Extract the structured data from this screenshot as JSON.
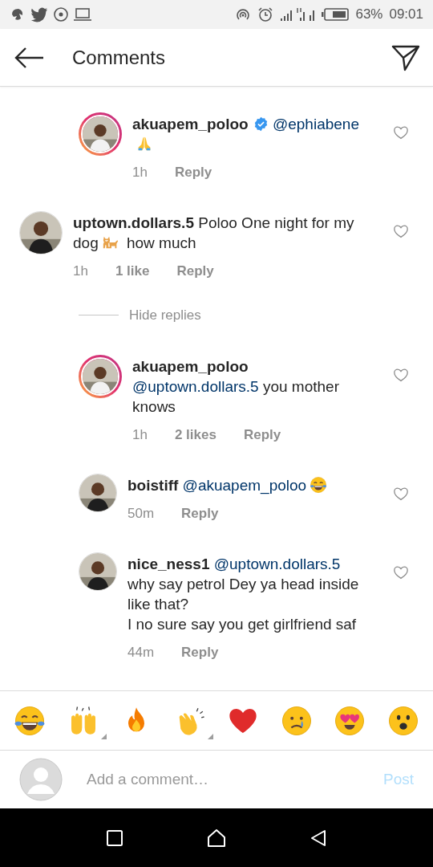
{
  "status_bar": {
    "battery": "63%",
    "time": "09:01"
  },
  "header": {
    "title": "Comments"
  },
  "comments": [
    {
      "username": "akuapem_poloo",
      "verified": true,
      "story_ring": true,
      "nested": true,
      "segments": [
        {
          "kind": "mention",
          "text": "@ephiabene"
        },
        {
          "kind": "pray"
        }
      ],
      "time": "1h",
      "reply": "Reply"
    },
    {
      "username": "uptown.dollars.5",
      "verified": false,
      "story_ring": false,
      "nested": false,
      "segments": [
        {
          "kind": "text",
          "text": "Poloo One night for my dog"
        },
        {
          "kind": "dog"
        },
        {
          "kind": "text",
          "text": "how much"
        }
      ],
      "time": "1h",
      "likes": "1 like",
      "reply": "Reply",
      "hide_replies": "Hide replies"
    },
    {
      "username": "akuapem_poloo",
      "verified": false,
      "story_ring": true,
      "nested": true,
      "segments": [
        {
          "kind": "mention",
          "text": "@uptown.dollars.5"
        },
        {
          "kind": "text",
          "text": "you mother knows"
        }
      ],
      "time": "1h",
      "likes": "2 likes",
      "reply": "Reply"
    },
    {
      "username": "boistiff",
      "verified": false,
      "story_ring": false,
      "nested": true,
      "segments": [
        {
          "kind": "mention",
          "text": "@akuapem_poloo"
        },
        {
          "kind": "laugh"
        }
      ],
      "time": "50m",
      "reply": "Reply"
    },
    {
      "username": "nice_ness1",
      "verified": false,
      "story_ring": false,
      "nested": true,
      "segments": [
        {
          "kind": "mention",
          "text": "@uptown.dollars.5"
        },
        {
          "kind": "text",
          "text": "why say petrol Dey ya head inside like that?"
        },
        {
          "kind": "break"
        },
        {
          "kind": "text",
          "text": "I no sure say you get girlfriend saf"
        }
      ],
      "time": "44m",
      "reply": "Reply"
    }
  ],
  "emoji_bar": [
    {
      "kind": "laugh",
      "more": false
    },
    {
      "kind": "raised-hands",
      "more": true
    },
    {
      "kind": "fire",
      "more": false
    },
    {
      "kind": "clap",
      "more": true
    },
    {
      "kind": "heart",
      "more": false
    },
    {
      "kind": "cry",
      "more": false
    },
    {
      "kind": "heart-eyes",
      "more": false
    },
    {
      "kind": "wow",
      "more": false
    }
  ],
  "composer": {
    "placeholder": "Add a comment…",
    "post": "Post"
  }
}
